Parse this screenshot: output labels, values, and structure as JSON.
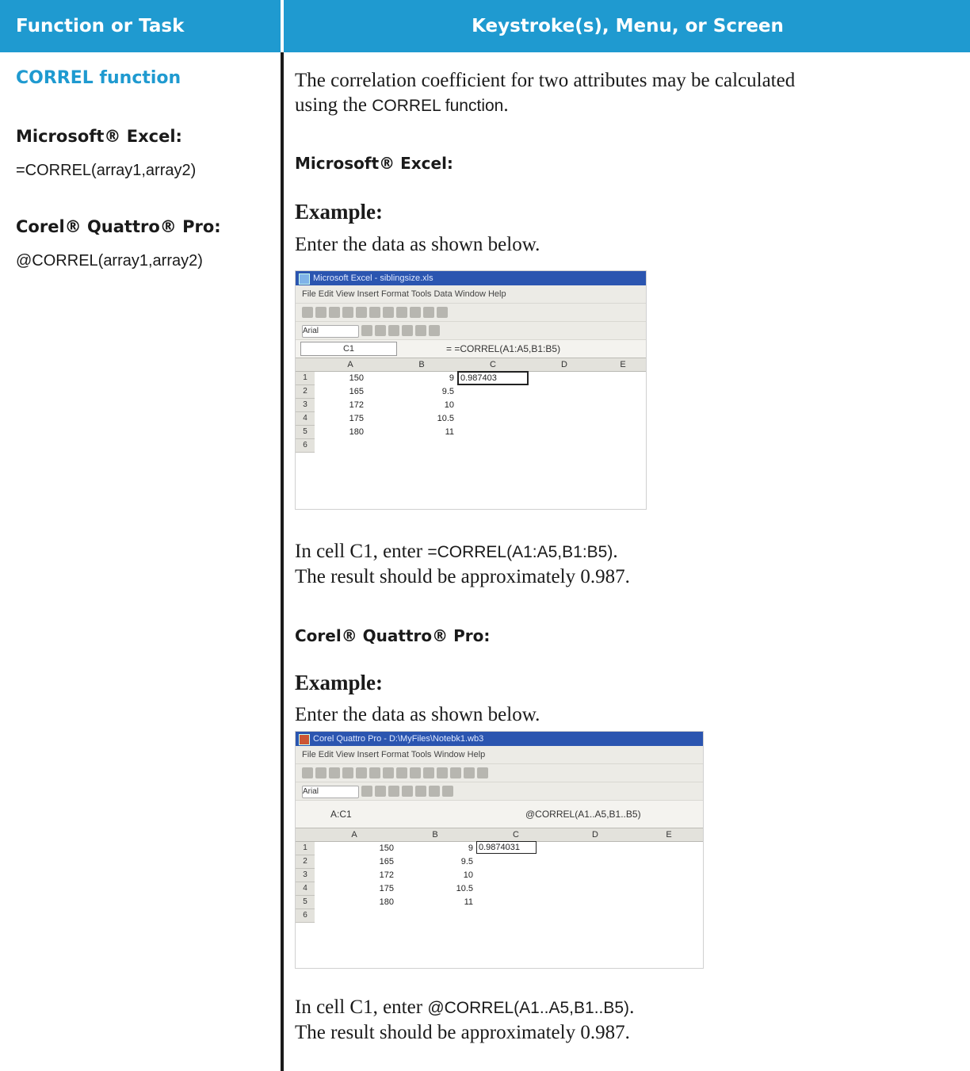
{
  "header": {
    "col1": "Function or Task",
    "col2": "Keystroke(s), Menu, or Screen"
  },
  "left": {
    "function_name": "CORREL function",
    "excel_heading": "Microsoft® Excel:",
    "excel_syntax": "=CORREL(array1,array2)",
    "quattro_heading": "Corel® Quattro® Pro:",
    "quattro_syntax": "@CORREL(array1,array2)"
  },
  "right": {
    "intro_1": "The correlation coefficient for two attributes may be calculated",
    "intro_2a": "using the ",
    "intro_2b": "CORREL function",
    "intro_2c": ".",
    "excel_heading": "Microsoft® Excel:",
    "excel_example": "Example:",
    "excel_enter": "Enter the data as shown below.",
    "excel_step_a": "In cell C1, enter ",
    "excel_step_b": "=CORREL(A1:A5,B1:B5)",
    "excel_step_c": ".",
    "excel_result": "The result should be approximately 0.987.",
    "quattro_heading": "Corel® Quattro® Pro:",
    "quattro_example": "Example:",
    "quattro_enter": "Enter the data as shown below.",
    "quattro_step_a": "In cell C1, enter ",
    "quattro_step_b": "@CORREL(A1..A5,B1..B5)",
    "quattro_step_c": ".",
    "quattro_result": "The result should be approximately 0.987."
  },
  "excel_shot": {
    "title": "Microsoft Excel - siblingsize.xls",
    "menu": "File  Edit  View  Insert  Format  Tools  Data  Window  Help",
    "font_box": "Arial",
    "name_box": "C1",
    "formula": "= =CORREL(A1:A5,B1:B5)",
    "columns": [
      "A",
      "B",
      "C",
      "D",
      "E"
    ],
    "rows": [
      "1",
      "2",
      "3",
      "4",
      "5",
      "6"
    ],
    "col_a": [
      "150",
      "165",
      "172",
      "175",
      "180"
    ],
    "col_b": [
      "9",
      "9.5",
      "10",
      "10.5",
      "11"
    ],
    "c1": "0.987403"
  },
  "quattro_shot": {
    "title": "Corel Quattro Pro - D:\\MyFiles\\Notebk1.wb3",
    "menu": "File  Edit  View  Insert  Format  Tools  Window  Help",
    "font_box": "Arial",
    "name_box": "A:C1",
    "formula": "@CORREL(A1..A5,B1..B5)",
    "columns": [
      "A",
      "B",
      "C",
      "D",
      "E"
    ],
    "rows": [
      "1",
      "2",
      "3",
      "4",
      "5",
      "6"
    ],
    "col_a": [
      "150",
      "165",
      "172",
      "175",
      "180"
    ],
    "col_b": [
      "9",
      "9.5",
      "10",
      "10.5",
      "11"
    ],
    "c1": "0.9874031"
  }
}
